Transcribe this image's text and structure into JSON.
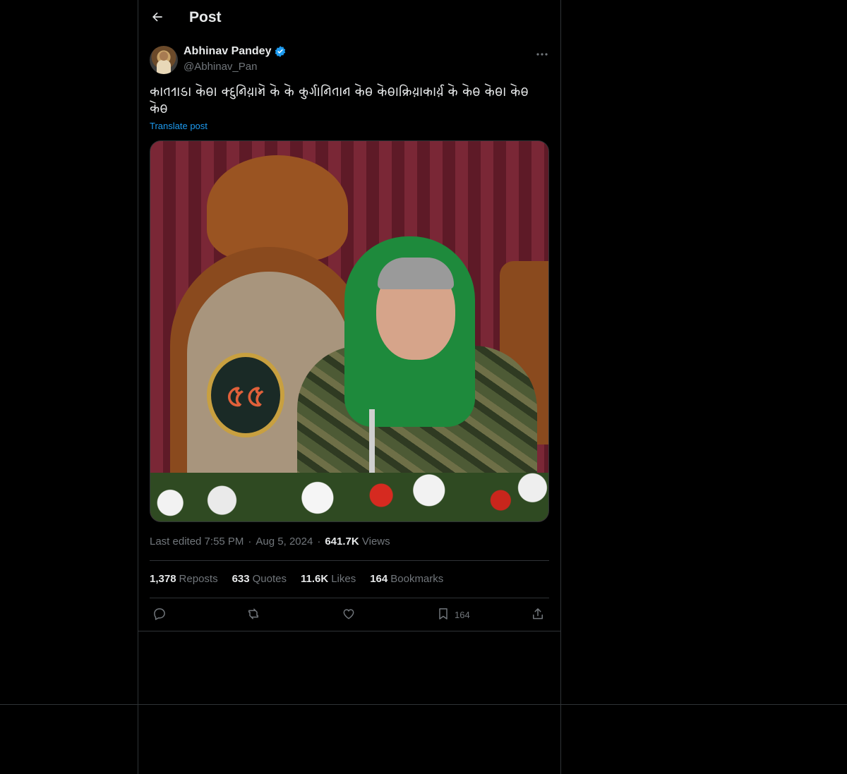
{
  "header": {
    "title": "Post"
  },
  "author": {
    "name": "Abhinav Pandey",
    "handle": "@Abhinav_Pan",
    "verified": true
  },
  "post": {
    "text": "𑂍𑂰𑂞𑂩𑂰𑂙𑂰 𑂍𑂵𑂪𑂰 𑂍𑂹𑂠𑂳𑂢𑂱𑂨𑂰𑂧𑂵 𑂍𑂵 𑂍𑂵 𑂍𑂳𑂩𑂹𑂏𑂰𑂢𑂱𑂞𑂰𑂢 𑂍𑂵𑂪 𑂍𑂵𑂪𑂰𑂍𑂹𑂩𑂱𑂨𑂰𑂍𑂰𑂩𑂹𑂨 𑂍𑂵 𑂍𑂵𑂪 𑂍𑂵𑂪𑂰 𑂍𑂵𑂪 𑂍𑂵𑂪",
    "translate_label": "Translate post",
    "media_badge_text": "৫৫"
  },
  "meta": {
    "edited": "Last edited 7:55 PM",
    "separator": "·",
    "date": "Aug 5, 2024",
    "views_count": "641.7K",
    "views_label": "Views"
  },
  "stats": {
    "reposts_count": "1,378",
    "reposts_label": "Reposts",
    "quotes_count": "633",
    "quotes_label": "Quotes",
    "likes_count": "11.6K",
    "likes_label": "Likes",
    "bookmarks_count": "164",
    "bookmarks_label": "Bookmarks"
  },
  "actions": {
    "bookmark_count": "164"
  },
  "colors": {
    "background": "#000000",
    "border": "#2f3336",
    "text_primary": "#e7e9ea",
    "text_secondary": "#71767b",
    "accent": "#1d9bf0"
  },
  "icons": {
    "back": "arrow-left-icon",
    "verified": "verified-badge-icon",
    "more": "more-horizontal-icon",
    "reply": "reply-icon",
    "repost": "repost-icon",
    "like": "heart-icon",
    "bookmark": "bookmark-icon",
    "share": "share-icon"
  }
}
